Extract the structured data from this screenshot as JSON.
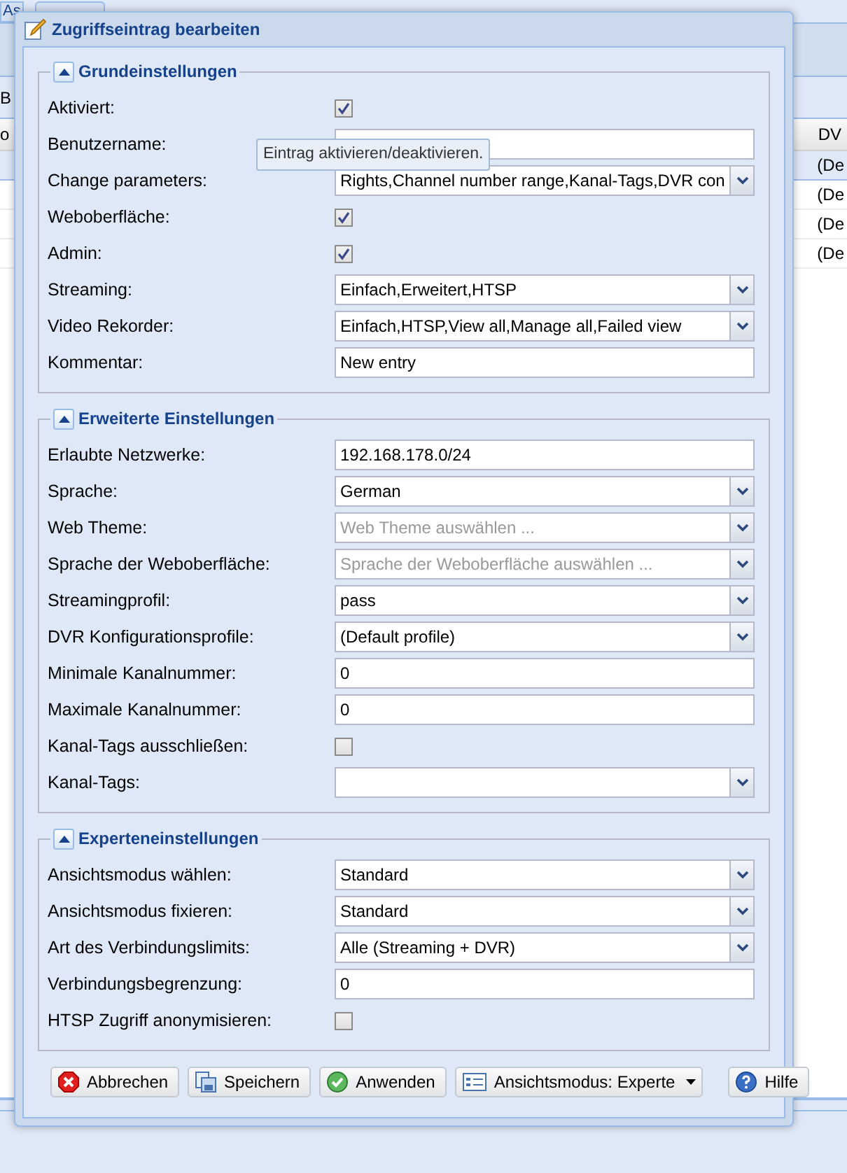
{
  "background": {
    "tab": "As",
    "toolbar_text": "B",
    "grid_header": {
      "column_1": "o",
      "column_2": "DV"
    },
    "grid_rows": [
      {
        "column_2": "(De",
        "selected": true
      },
      {
        "column_2": "(De",
        "selected": false
      },
      {
        "column_2": "(De",
        "selected": false
      },
      {
        "column_2": "(De",
        "selected": false
      }
    ]
  },
  "dialog": {
    "title": "Zugriffseintrag bearbeiten",
    "sections": [
      {
        "title": "Grundeinstellungen",
        "expanded": true,
        "fields": [
          {
            "label": "Aktiviert:",
            "kind": "checkbox",
            "checked": true
          },
          {
            "label": "Benutzername:",
            "kind": "text"
          },
          {
            "label": "Change parameters:",
            "kind": "select",
            "value": "Rights,Channel number range,Kanal-Tags,DVR con"
          },
          {
            "label": "Weboberfläche:",
            "kind": "checkbox",
            "checked": true
          },
          {
            "label": "Admin:",
            "kind": "checkbox",
            "checked": true
          },
          {
            "label": "Streaming:",
            "kind": "select",
            "value": "Einfach,Erweitert,HTSP"
          },
          {
            "label": "Video Rekorder:",
            "kind": "select",
            "value": "Einfach,HTSP,View all,Manage all,Failed view"
          },
          {
            "label": "Kommentar:",
            "kind": "text",
            "value": "New entry"
          }
        ]
      },
      {
        "title": "Erweiterte Einstellungen",
        "expanded": true,
        "fields": [
          {
            "label": "Erlaubte Netzwerke:",
            "kind": "text",
            "value": "192.168.178.0/24"
          },
          {
            "label": "Sprache:",
            "kind": "select",
            "value": "German"
          },
          {
            "label": "Web Theme:",
            "kind": "select",
            "placeholder": "Web Theme auswählen ..."
          },
          {
            "label": "Sprache der Weboberfläche:",
            "kind": "select",
            "placeholder": "Sprache der Weboberfläche auswählen ..."
          },
          {
            "label": "Streamingprofil:",
            "kind": "select",
            "value": "pass"
          },
          {
            "label": "DVR Konfigurationsprofile:",
            "kind": "select",
            "value": "(Default profile)"
          },
          {
            "label": "Minimale Kanalnummer:",
            "kind": "text",
            "value": "0"
          },
          {
            "label": "Maximale Kanalnummer:",
            "kind": "text",
            "value": "0"
          },
          {
            "label": "Kanal-Tags ausschließen:",
            "kind": "checkbox",
            "checked": false
          },
          {
            "label": "Kanal-Tags:",
            "kind": "select"
          }
        ]
      },
      {
        "title": "Experteneinstellungen",
        "expanded": true,
        "fields": [
          {
            "label": "Ansichtsmodus wählen:",
            "kind": "select",
            "value": "Standard"
          },
          {
            "label": "Ansichtsmodus fixieren:",
            "kind": "select",
            "value": "Standard"
          },
          {
            "label": "Art des Verbindungslimits:",
            "kind": "select",
            "value": "Alle (Streaming + DVR)"
          },
          {
            "label": "Verbindungsbegrenzung:",
            "kind": "text",
            "value": "0"
          },
          {
            "label": "HTSP Zugriff anonymisieren:",
            "kind": "checkbox",
            "checked": false
          }
        ]
      }
    ],
    "tooltip": "Eintrag aktivieren/deaktivieren.",
    "buttons": [
      {
        "label": "Abbrechen",
        "kind": "cancel",
        "dropdown": false
      },
      {
        "label": "Speichern",
        "kind": "save",
        "dropdown": false
      },
      {
        "label": "Anwenden",
        "kind": "apply",
        "dropdown": false
      },
      {
        "label": "Ansichtsmodus: Experte",
        "kind": "view",
        "dropdown": true
      },
      {
        "label": "Hilfe",
        "kind": "help",
        "dropdown": false
      }
    ]
  }
}
